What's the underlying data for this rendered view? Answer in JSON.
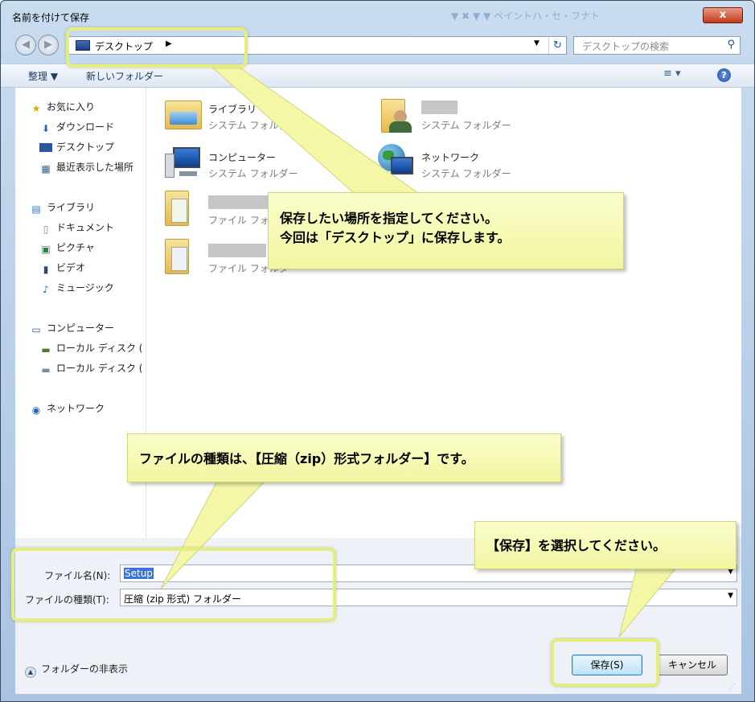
{
  "window": {
    "title": "名前を付けて保存",
    "bg_title_fragment": "▼  ✖  ▼  ▼  ペイントハ・セ・フナト",
    "close_label": "x"
  },
  "nav": {
    "address": "デスクトップ",
    "address_arrow": "▶",
    "dropdown": "▼",
    "search_placeholder": "デスクトップの検索"
  },
  "toolbar": {
    "organize": "整理 ▼",
    "new_folder": "新しいフォルダー",
    "view_icon": "≡",
    "help_icon": "?"
  },
  "sidebar": {
    "items": [
      {
        "label": "お気に入り",
        "icon": "star-icon"
      },
      {
        "label": "ダウンロード",
        "icon": "download-icon"
      },
      {
        "label": "デスクトップ",
        "icon": "desktop-icon"
      },
      {
        "label": "最近表示した場所",
        "icon": "recent-places-icon"
      },
      {
        "label": "ライブラリ",
        "icon": "library-icon"
      },
      {
        "label": "ドキュメント",
        "icon": "document-icon"
      },
      {
        "label": "ピクチャ",
        "icon": "picture-icon"
      },
      {
        "label": "ビデオ",
        "icon": "video-icon"
      },
      {
        "label": "ミュージック",
        "icon": "music-icon"
      },
      {
        "label": "コンピューター",
        "icon": "computer-icon"
      },
      {
        "label": "ローカル ディスク (",
        "icon": "local-disk-icon"
      },
      {
        "label": "ローカル ディスク (",
        "icon": "local-disk-icon"
      },
      {
        "label": "ネットワーク",
        "icon": "network-icon"
      }
    ]
  },
  "files": [
    {
      "name": "ライブラリ",
      "type": "システム フォルダー",
      "icon": "library-folder-icon"
    },
    {
      "name": "",
      "type": "システム フォルダー",
      "icon": "user-folder-icon"
    },
    {
      "name": "コンピューター",
      "type": "システム フォルダー",
      "icon": "computer-icon"
    },
    {
      "name": "ネットワーク",
      "type": "システム フォルダー",
      "icon": "network-globe-icon"
    },
    {
      "name": "",
      "type": "ファイル フォルダー",
      "icon": "folder-icon"
    },
    {
      "name": "",
      "type": "ファイル フォルダー",
      "icon": "folder-icon"
    }
  ],
  "form": {
    "filename_label": "ファイル名(N):",
    "filename_value": "Setup",
    "filetype_label": "ファイルの種類(T):",
    "filetype_value": "圧縮 (zip 形式) フォルダー",
    "hide_folders": "フォルダーの非表示",
    "save_button": "保存(S)",
    "cancel_button": "キャンセル"
  },
  "callouts": {
    "location_line1": "保存したい場所を指定してください。",
    "location_line2": "今回は「デスクトップ」に保存します。",
    "filetype": "ファイルの種類は、【圧縮（zip）形式フォルダー】です。",
    "save": "【保存】を選択してください。"
  },
  "colors": {
    "callout_bg": "#f1f6a1",
    "highlight_border": "#e3ee7e",
    "selection": "#3875d7"
  }
}
